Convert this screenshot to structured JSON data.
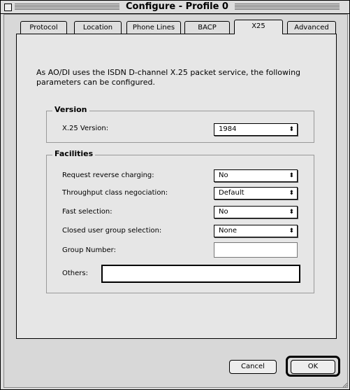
{
  "window": {
    "title": "Configure - Profile 0"
  },
  "tabs": [
    {
      "label": "Protocol",
      "active": false
    },
    {
      "label": "Location",
      "active": false
    },
    {
      "label": "Phone Lines",
      "active": false
    },
    {
      "label": "BACP",
      "active": false
    },
    {
      "label": "X25",
      "active": true
    },
    {
      "label": "Advanced",
      "active": false
    }
  ],
  "intro": "As AO/DI uses the ISDN D-channel X.25 packet service, the following parameters can be configured.",
  "version": {
    "title": "Version",
    "x25_label": "X.25 Version:",
    "x25_value": "1984"
  },
  "facilities": {
    "title": "Facilities",
    "reverse_charging_label": "Request reverse charging:",
    "reverse_charging_value": "No",
    "throughput_label": "Throughput class negociation:",
    "throughput_value": "Default",
    "fast_selection_label": "Fast selection:",
    "fast_selection_value": "No",
    "cug_label": "Closed user group selection:",
    "cug_value": "None",
    "group_number_label": "Group Number:",
    "group_number_value": "",
    "others_label": "Others:",
    "others_value": ""
  },
  "buttons": {
    "cancel": "Cancel",
    "ok": "OK"
  },
  "icons": {
    "popup_arrows": "⬍"
  }
}
